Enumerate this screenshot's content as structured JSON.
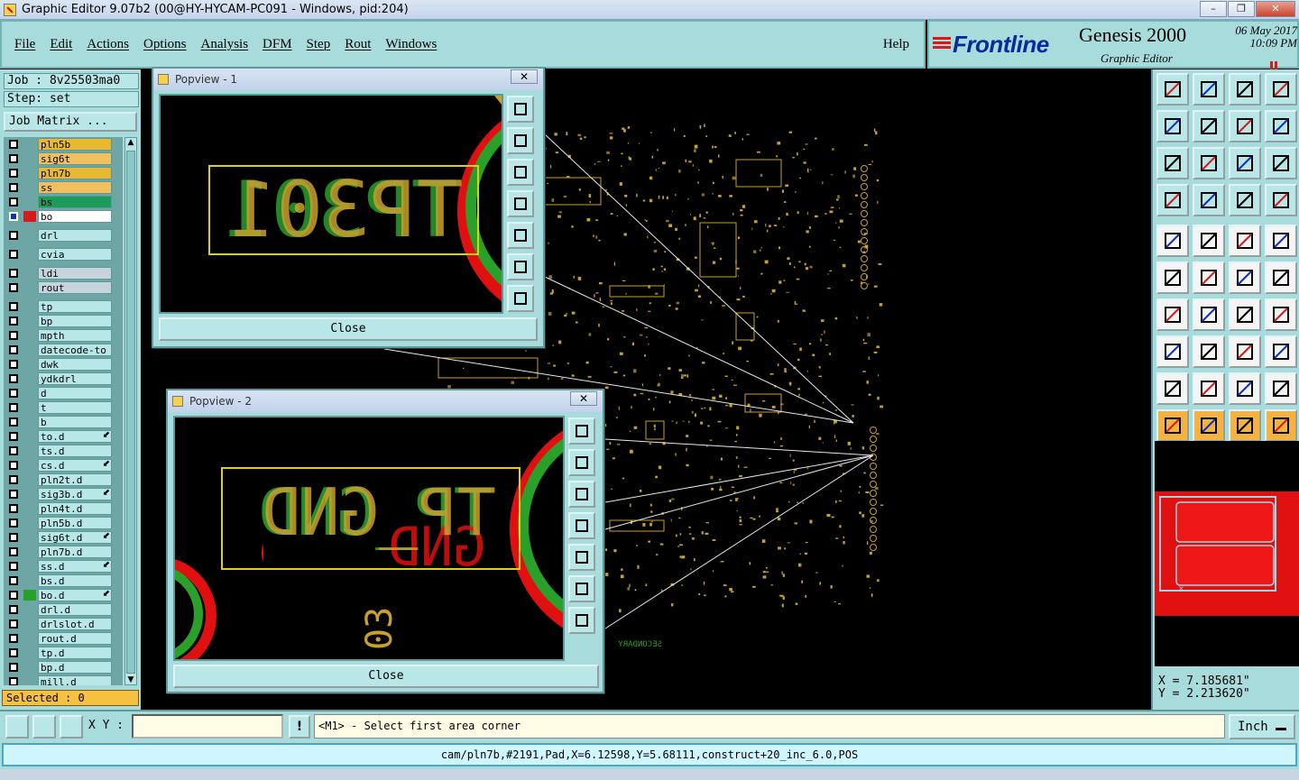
{
  "window": {
    "title": "Graphic Editor 9.07b2 (00@HY-HYCAM-PC091 - Windows, pid:204)",
    "minimize": "–",
    "restore": "❐",
    "close": "✕"
  },
  "menu": {
    "items": [
      "File",
      "Edit",
      "Actions",
      "Options",
      "Analysis",
      "DFM",
      "Step",
      "Rout",
      "Windows"
    ],
    "help": "Help"
  },
  "brand": {
    "logo": "Frontline",
    "product": "Genesis 2000",
    "subtitle": "Graphic Editor",
    "date": "06 May 2017",
    "time": "10:09 PM"
  },
  "job": {
    "job_line": "Job : 8v25503ma0",
    "step_line": "Step: set",
    "matrix_button": "Job Matrix ..."
  },
  "layers": [
    {
      "name": "pln5b",
      "color": "#e8b830",
      "swatch": ""
    },
    {
      "name": "sig6t",
      "color": "#f0c060",
      "swatch": ""
    },
    {
      "name": "pln7b",
      "color": "#e8b830",
      "swatch": ""
    },
    {
      "name": "ss",
      "color": "#f0c060",
      "swatch": ""
    },
    {
      "name": "bs",
      "color": "#1e9a5a",
      "swatch": ""
    },
    {
      "name": "bo",
      "color": "#ffffff",
      "swatch": "#d41c1c",
      "active": true
    },
    {
      "name": "drl",
      "color": "#b9e6e6",
      "swatch": "",
      "gap": true
    },
    {
      "name": "cvia",
      "color": "#b9e6e6",
      "swatch": "",
      "gap": true
    },
    {
      "name": "ldi",
      "color": "#c8d4dc",
      "swatch": "",
      "gap": true
    },
    {
      "name": "rout",
      "color": "#c8d4dc",
      "swatch": ""
    },
    {
      "name": "tp",
      "color": "#b9e6e6",
      "swatch": "",
      "gap": true
    },
    {
      "name": "bp",
      "color": "#b9e6e6",
      "swatch": ""
    },
    {
      "name": "mpth",
      "color": "#b9e6e6",
      "swatch": ""
    },
    {
      "name": "datecode-to",
      "color": "#b9e6e6",
      "swatch": ""
    },
    {
      "name": "dwk",
      "color": "#b9e6e6",
      "swatch": ""
    },
    {
      "name": "ydkdrl",
      "color": "#b9e6e6",
      "swatch": ""
    },
    {
      "name": "d",
      "color": "#b9e6e6",
      "swatch": ""
    },
    {
      "name": "t",
      "color": "#b9e6e6",
      "swatch": ""
    },
    {
      "name": "b",
      "color": "#b9e6e6",
      "swatch": ""
    },
    {
      "name": "to.d",
      "color": "#b9e6e6",
      "swatch": "",
      "flag": true
    },
    {
      "name": "ts.d",
      "color": "#b9e6e6",
      "swatch": ""
    },
    {
      "name": "cs.d",
      "color": "#b9e6e6",
      "swatch": "",
      "flag": true
    },
    {
      "name": "pln2t.d",
      "color": "#b9e6e6",
      "swatch": ""
    },
    {
      "name": "sig3b.d",
      "color": "#b9e6e6",
      "swatch": "",
      "flag": true
    },
    {
      "name": "pln4t.d",
      "color": "#b9e6e6",
      "swatch": ""
    },
    {
      "name": "pln5b.d",
      "color": "#b9e6e6",
      "swatch": ""
    },
    {
      "name": "sig6t.d",
      "color": "#b9e6e6",
      "swatch": "",
      "flag": true
    },
    {
      "name": "pln7b.d",
      "color": "#b9e6e6",
      "swatch": ""
    },
    {
      "name": "ss.d",
      "color": "#b9e6e6",
      "swatch": "",
      "flag": true
    },
    {
      "name": "bs.d",
      "color": "#b9e6e6",
      "swatch": ""
    },
    {
      "name": "bo.d",
      "color": "#b9e6e6",
      "swatch": "#2aa02a",
      "flag": true
    },
    {
      "name": "drl.d",
      "color": "#b9e6e6",
      "swatch": ""
    },
    {
      "name": "drlslot.d",
      "color": "#b9e6e6",
      "swatch": ""
    },
    {
      "name": "rout.d",
      "color": "#b9e6e6",
      "swatch": ""
    },
    {
      "name": "tp.d",
      "color": "#b9e6e6",
      "swatch": ""
    },
    {
      "name": "bp.d",
      "color": "#b9e6e6",
      "swatch": ""
    },
    {
      "name": "mill.d",
      "color": "#b9e6e6",
      "swatch": ""
    }
  ],
  "selected": "Selected : 0",
  "popview1": {
    "title": "Popview - 1",
    "close_x": "✕",
    "close": "Close",
    "label": "TP301"
  },
  "popview2": {
    "title": "Popview - 2",
    "close_x": "✕",
    "close": "Close",
    "label": "TP_GND",
    "fragment": "03"
  },
  "canvas": {
    "secondary_text": "SECONDARY"
  },
  "coords": {
    "x": "X = 7.185681\"",
    "y": "Y = 2.213620\""
  },
  "command": {
    "xy_label": "X Y :",
    "xy_value": "",
    "warn": "!",
    "prompt": "<M1> - Select first area corner",
    "units": "Inch"
  },
  "status": "cam/pln7b,#2191,Pad,X=6.12598,Y=5.68111,construct+20_inc_6.0,POS",
  "colors": {
    "panel": "#a8dcdc",
    "accent_red": "#d41c1c",
    "trace_yellow": "#c8a030",
    "green": "#2aa02a",
    "orange": "#f6b23e"
  }
}
